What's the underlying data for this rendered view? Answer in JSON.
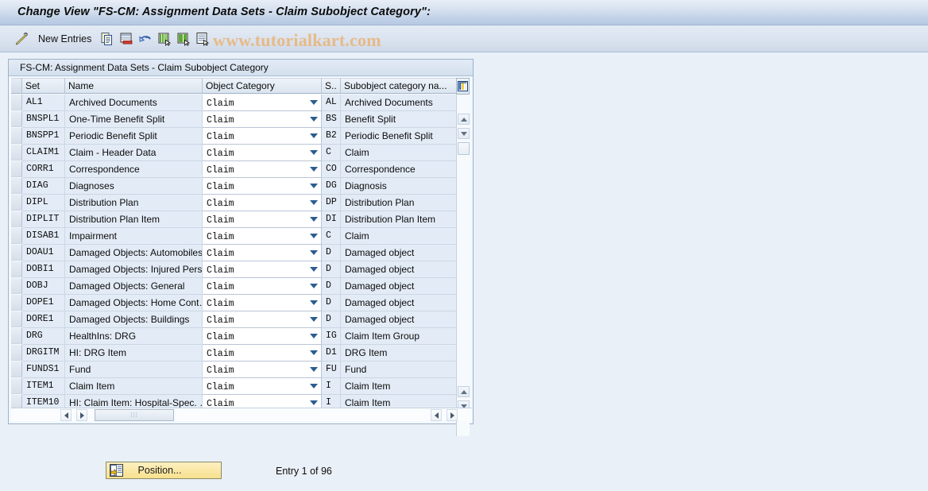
{
  "window": {
    "title": "Change View \"FS-CM: Assignment Data Sets - Claim Subobject Category\":"
  },
  "toolbar": {
    "new_entries_label": "New Entries",
    "icons": [
      {
        "name": "display-change-icon"
      },
      {
        "name": "copy-as-icon"
      },
      {
        "name": "delete-icon"
      },
      {
        "name": "undo-icon"
      },
      {
        "name": "select-all-icon"
      },
      {
        "name": "deselect-all-icon"
      },
      {
        "name": "variant-icon"
      }
    ]
  },
  "watermark": {
    "text": "www.tutorialkart.com",
    "color": "#e8b882"
  },
  "panel": {
    "title": "FS-CM: Assignment Data Sets - Claim Subobject Category",
    "columns": [
      {
        "key": "set",
        "label": "Set"
      },
      {
        "key": "name",
        "label": "Name"
      },
      {
        "key": "object_category",
        "label": "Object Category"
      },
      {
        "key": "subobject_key",
        "label": "S.."
      },
      {
        "key": "subobject_category_name",
        "label": "Subobject category na..."
      }
    ],
    "config_icon": "column-settings-icon",
    "rows": [
      {
        "set": "AL1",
        "name": "Archived Documents",
        "object_category": "Claim",
        "subobject_key": "AL",
        "subobject_category_name": "Archived Documents"
      },
      {
        "set": "BNSPL1",
        "name": "One-Time Benefit Split",
        "object_category": "Claim",
        "subobject_key": "BS",
        "subobject_category_name": "Benefit Split"
      },
      {
        "set": "BNSPP1",
        "name": "Periodic Benefit Split",
        "object_category": "Claim",
        "subobject_key": "B2",
        "subobject_category_name": "Periodic Benefit Split"
      },
      {
        "set": "CLAIM1",
        "name": "Claim - Header Data",
        "object_category": "Claim",
        "subobject_key": "C",
        "subobject_category_name": "Claim"
      },
      {
        "set": "CORR1",
        "name": "Correspondence",
        "object_category": "Claim",
        "subobject_key": "CO",
        "subobject_category_name": "Correspondence"
      },
      {
        "set": "DIAG",
        "name": "Diagnoses",
        "object_category": "Claim",
        "subobject_key": "DG",
        "subobject_category_name": "Diagnosis"
      },
      {
        "set": "DIPL",
        "name": "Distribution Plan",
        "object_category": "Claim",
        "subobject_key": "DP",
        "subobject_category_name": "Distribution Plan"
      },
      {
        "set": "DIPLIT",
        "name": "Distribution Plan Item",
        "object_category": "Claim",
        "subobject_key": "DI",
        "subobject_category_name": "Distribution Plan Item"
      },
      {
        "set": "DISAB1",
        "name": "Impairment",
        "object_category": "Claim",
        "subobject_key": "C",
        "subobject_category_name": "Claim"
      },
      {
        "set": "DOAU1",
        "name": "Damaged Objects: Automobiles",
        "object_category": "Claim",
        "subobject_key": "D",
        "subobject_category_name": "Damaged object"
      },
      {
        "set": "DOBI1",
        "name": "Damaged Objects: Injured Pers…",
        "object_category": "Claim",
        "subobject_key": "D",
        "subobject_category_name": "Damaged object"
      },
      {
        "set": "DOBJ",
        "name": "Damaged Objects: General",
        "object_category": "Claim",
        "subobject_key": "D",
        "subobject_category_name": "Damaged object"
      },
      {
        "set": "DOPE1",
        "name": "Damaged Objects: Home Cont…",
        "object_category": "Claim",
        "subobject_key": "D",
        "subobject_category_name": "Damaged object"
      },
      {
        "set": "DORE1",
        "name": "Damaged Objects: Buildings",
        "object_category": "Claim",
        "subobject_key": "D",
        "subobject_category_name": "Damaged object"
      },
      {
        "set": "DRG",
        "name": "HealthIns: DRG",
        "object_category": "Claim",
        "subobject_key": "IG",
        "subobject_category_name": "Claim Item Group"
      },
      {
        "set": "DRGITM",
        "name": "HI: DRG Item",
        "object_category": "Claim",
        "subobject_key": "D1",
        "subobject_category_name": "DRG Item"
      },
      {
        "set": "FUNDS1",
        "name": "Fund",
        "object_category": "Claim",
        "subobject_key": "FU",
        "subobject_category_name": "Fund"
      },
      {
        "set": "ITEM1",
        "name": "Claim Item",
        "object_category": "Claim",
        "subobject_key": "I",
        "subobject_category_name": "Claim Item"
      },
      {
        "set": "ITEM10",
        "name": "HI: Claim Item: Hospital-Spec. …",
        "object_category": "Claim",
        "subobject_key": "I",
        "subobject_category_name": "Claim Item"
      }
    ]
  },
  "footer": {
    "position_button_label": "Position...",
    "entry_status": "Entry 1 of 96"
  }
}
